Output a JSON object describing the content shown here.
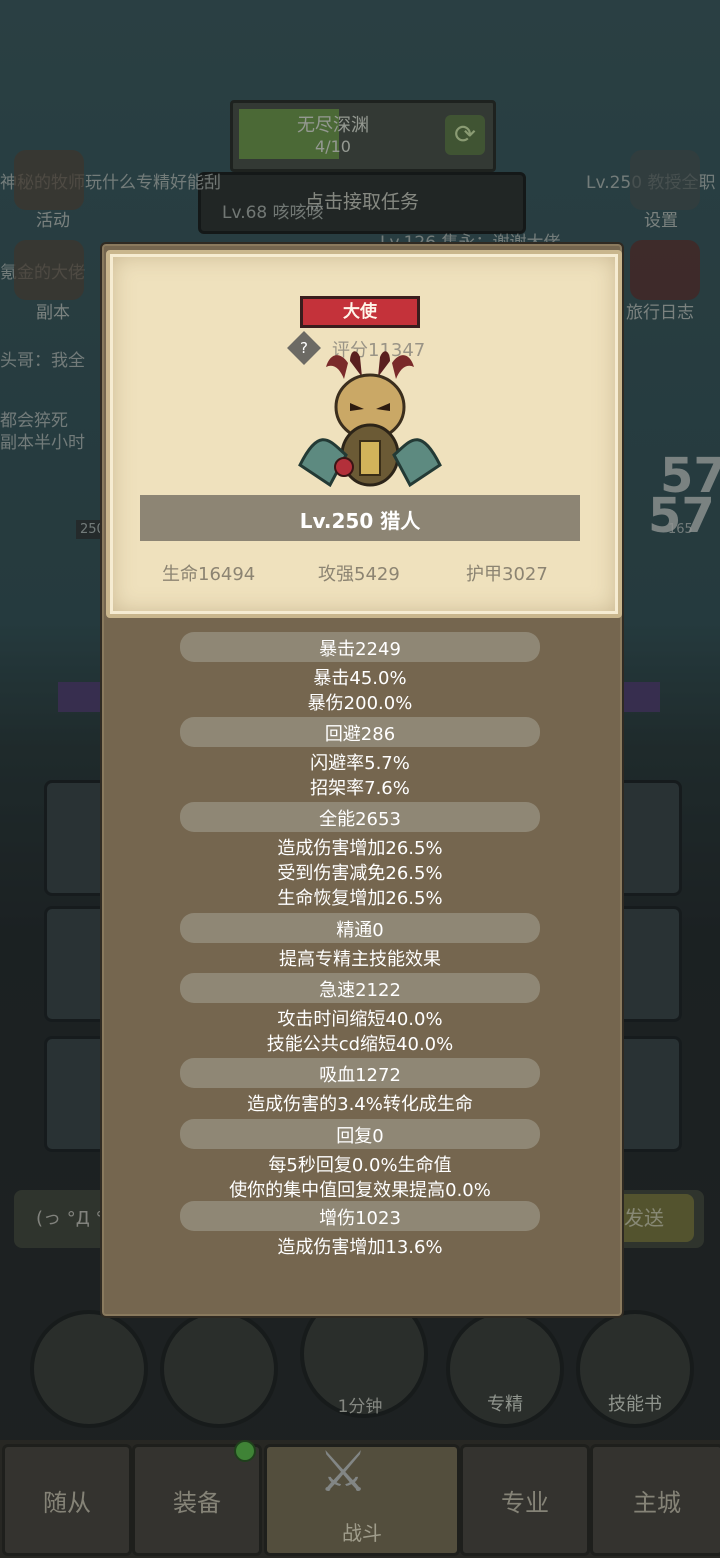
{
  "background": {
    "dungeon": {
      "title": "无尽深渊",
      "progress": "4/10",
      "progress_value": 0.4
    },
    "task_button": "点击接取任务",
    "chat_lines": [
      "Lv.68 咳咳咳",
      "Lv.126 集永：谢谢大佬",
      "Lv.250 教授全职",
      "氪金的大佬",
      "头哥：我全",
      "都会猝死",
      "副本半小时"
    ],
    "scroll_text": "神秘的牧师玩什么专精好能刮",
    "left_icons": [
      {
        "label": "活动"
      },
      {
        "label": "副本"
      }
    ],
    "right_icons": [
      {
        "label": "设置"
      },
      {
        "label": "旅行日志"
      }
    ],
    "damage_numbers": [
      "57",
      "57"
    ],
    "enemy_level_left": "250",
    "enemy_level_right": "165",
    "chat_input_face": "(っ °Д °",
    "send_label": "发送",
    "actions": [
      {
        "label": ""
      },
      {
        "label": ""
      },
      {
        "label": "1分钟"
      },
      {
        "label": "专精"
      },
      {
        "label": "技能书"
      }
    ],
    "nav": [
      {
        "label": "随从"
      },
      {
        "label": "装备"
      },
      {
        "label": "战斗"
      },
      {
        "label": "专业"
      },
      {
        "label": "主城"
      }
    ]
  },
  "modal": {
    "rank_badge": "大使",
    "score": "评分11347",
    "name": "Lv.250 猎人",
    "base_stats": [
      "生命16494",
      "攻强5429",
      "护甲3027"
    ],
    "sections": [
      {
        "header": "暴击2249",
        "lines": [
          "暴击45.0%",
          "暴伤200.0%"
        ]
      },
      {
        "header": "回避286",
        "lines": [
          "闪避率5.7%",
          "招架率7.6%"
        ]
      },
      {
        "header": "全能2653",
        "lines": [
          "造成伤害增加26.5%",
          "受到伤害减免26.5%",
          "生命恢复增加26.5%"
        ]
      },
      {
        "header": "精通0",
        "lines": [
          "提高专精主技能效果"
        ]
      },
      {
        "header": "急速2122",
        "lines": [
          "攻击时间缩短40.0%",
          "技能公共cd缩短40.0%"
        ]
      },
      {
        "header": "吸血1272",
        "lines": [
          "造成伤害的3.4%转化成生命"
        ]
      },
      {
        "header": "回复0",
        "lines": [
          "每5秒回复0.0%生命值",
          "使你的集中值回复效果提高0.0%"
        ]
      },
      {
        "header": "增伤1023",
        "lines": [
          "造成伤害增加13.6%"
        ]
      }
    ]
  },
  "colors": {
    "rank_red": "#c4323a",
    "modal_bg": "#75664f",
    "card_bg": "#efe1bd",
    "header_pill": "#8f8775"
  },
  "icons": [
    "help-icon",
    "hunter-portrait-icon",
    "refresh-icon",
    "crossed-swords-icon"
  ]
}
